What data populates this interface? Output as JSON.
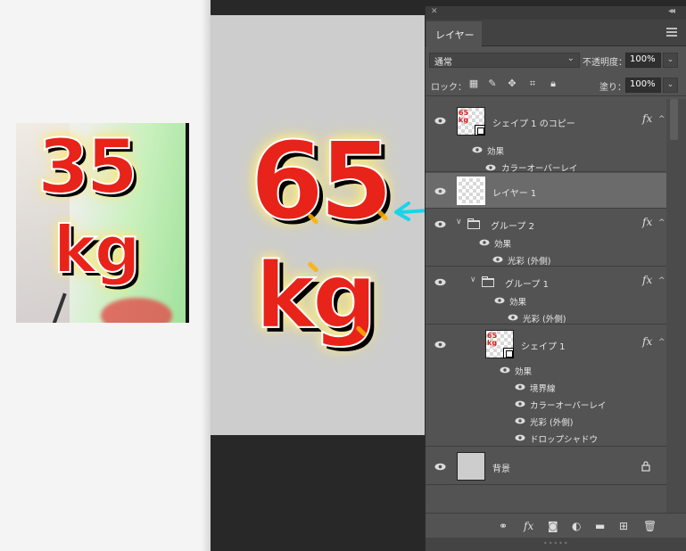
{
  "reference": {
    "number": "35",
    "unit": "kg"
  },
  "canvas": {
    "number": "65",
    "unit": "kg"
  },
  "panel": {
    "tab": "レイヤー",
    "blend_mode": "通常",
    "opacity_label": "不透明度：",
    "opacity": "100%",
    "lock_label": "ロック：",
    "fill_label": "塗り：",
    "fill": "100%",
    "layers": [
      {
        "name": "シェイプ 1 のコピー",
        "thumb_text": "65\nkg",
        "fx": "fx",
        "effects_label": "効果",
        "effects": [
          "カラーオーバーレイ"
        ]
      },
      {
        "name": "レイヤー 1",
        "selected": true
      },
      {
        "name": "グループ 2",
        "fx": "fx",
        "effects_label": "効果",
        "effects": [
          "光彩 (外側)"
        ]
      },
      {
        "name": "グループ 1",
        "fx": "fx",
        "effects_label": "効果",
        "effects": [
          "光彩 (外側)"
        ]
      },
      {
        "name": "シェイプ 1",
        "thumb_text": "65\nkg",
        "fx": "fx",
        "effects_label": "効果",
        "effects": [
          "境界線",
          "カラーオーバーレイ",
          "光彩 (外側)",
          "ドロップシャドウ"
        ]
      },
      {
        "name": "背景",
        "locked": true
      }
    ],
    "footer_icons": [
      "link-icon",
      "fx-icon",
      "mask-icon",
      "adjustment-icon",
      "folder-icon",
      "new-layer-icon",
      "trash-icon"
    ]
  },
  "colors": {
    "accent_arrow": "#19d4ea",
    "number_red": "#e8231a",
    "glow_yellow": "#ffe45a",
    "panel_bg": "#535353",
    "workspace": "#282828"
  }
}
